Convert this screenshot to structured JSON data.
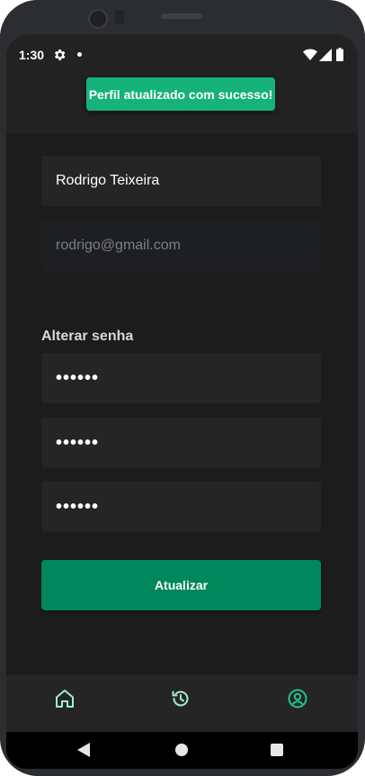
{
  "status_bar": {
    "time": "1:30",
    "icons": [
      "gear-icon",
      "notification-dot",
      "wifi-icon",
      "signal-icon",
      "battery-icon"
    ]
  },
  "toast": {
    "message": "Perfil atualizado com sucesso!",
    "color": "#15b27a"
  },
  "form": {
    "name_value": "Rodrigo Teixeira",
    "email_value": "rodrigo@gmail.com",
    "password_section_label": "Alterar senha",
    "current_password_value": "••••••",
    "new_password_value": "••••••",
    "confirm_password_value": "••••••",
    "submit_label": "Atualizar"
  },
  "bottom_nav": {
    "items": [
      {
        "icon": "home-icon",
        "active": false
      },
      {
        "icon": "history-icon",
        "active": false
      },
      {
        "icon": "profile-icon",
        "active": true
      }
    ],
    "active_color": "#1dc48c"
  },
  "colors": {
    "background": "#1c1c1c",
    "input_background": "#252525",
    "primary_button": "#00875c"
  }
}
